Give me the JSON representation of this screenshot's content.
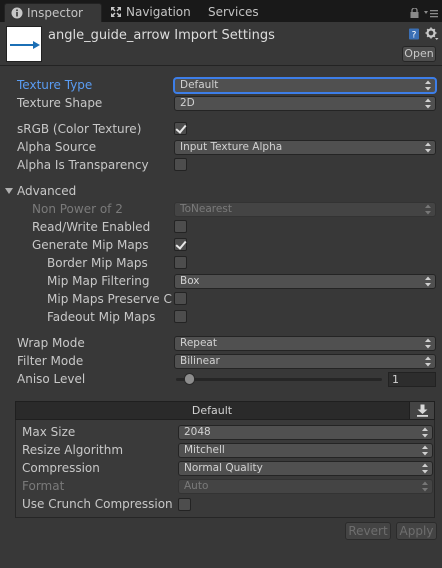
{
  "tabs": [
    {
      "label": "Inspector",
      "icon": "info-icon"
    },
    {
      "label": "Navigation",
      "icon": "navigation-icon"
    },
    {
      "label": "Services"
    }
  ],
  "header": {
    "title": "angle_guide_arrow Import Settings",
    "open_label": "Open"
  },
  "settings": {
    "texture_type": {
      "label": "Texture Type",
      "value": "Default"
    },
    "texture_shape": {
      "label": "Texture Shape",
      "value": "2D"
    },
    "srgb": {
      "label": "sRGB (Color Texture)",
      "checked": true
    },
    "alpha_source": {
      "label": "Alpha Source",
      "value": "Input Texture Alpha"
    },
    "alpha_transparency": {
      "label": "Alpha Is Transparency",
      "checked": false
    },
    "advanced": {
      "label": "Advanced"
    },
    "non_power_of_2": {
      "label": "Non Power of 2",
      "value": "ToNearest"
    },
    "read_write": {
      "label": "Read/Write Enabled",
      "checked": false
    },
    "generate_mip": {
      "label": "Generate Mip Maps",
      "checked": true
    },
    "border_mip": {
      "label": "Border Mip Maps",
      "checked": false
    },
    "mip_filtering": {
      "label": "Mip Map Filtering",
      "value": "Box"
    },
    "mip_preserve": {
      "label": "Mip Maps Preserve Cove",
      "checked": false
    },
    "fadeout_mip": {
      "label": "Fadeout Mip Maps",
      "checked": false
    },
    "wrap_mode": {
      "label": "Wrap Mode",
      "value": "Repeat"
    },
    "filter_mode": {
      "label": "Filter Mode",
      "value": "Bilinear"
    },
    "aniso": {
      "label": "Aniso Level",
      "value": "1"
    }
  },
  "platform": {
    "tab_label": "Default",
    "max_size": {
      "label": "Max Size",
      "value": "2048"
    },
    "resize": {
      "label": "Resize Algorithm",
      "value": "Mitchell"
    },
    "compression": {
      "label": "Compression",
      "value": "Normal Quality"
    },
    "format": {
      "label": "Format",
      "value": "Auto"
    },
    "crunch": {
      "label": "Use Crunch Compression",
      "checked": false
    }
  },
  "footer": {
    "revert": "Revert",
    "apply": "Apply"
  },
  "colors": {
    "accent": "#5a9cf3",
    "background": "#383838",
    "tabbar": "#191919"
  }
}
